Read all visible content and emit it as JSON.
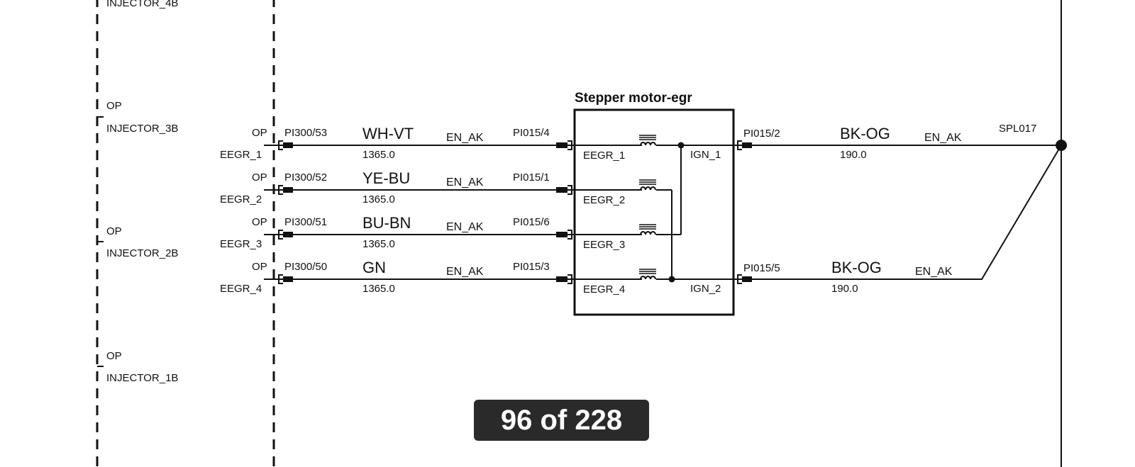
{
  "diagram": {
    "component_title": "Stepper motor-egr",
    "left_connectors": [
      {
        "op": "OP",
        "name": "INJECTOR_4B"
      },
      {
        "op": "OP",
        "name": "INJECTOR_3B"
      },
      {
        "op": "OP",
        "name": "INJECTOR_2B"
      },
      {
        "op": "OP",
        "name": "INJECTOR_1B"
      }
    ],
    "wires": [
      {
        "op": "OP",
        "pin": "EEGR_1",
        "from": "PI300/53",
        "color": "WH-VT",
        "length": "1365.0",
        "harness": "EN_AK",
        "to": "PI015/4",
        "internal": "EEGR_1"
      },
      {
        "op": "OP",
        "pin": "EEGR_2",
        "from": "PI300/52",
        "color": "YE-BU",
        "length": "1365.0",
        "harness": "EN_AK",
        "to": "PI015/1",
        "internal": "EEGR_2"
      },
      {
        "op": "OP",
        "pin": "EEGR_3",
        "from": "PI300/51",
        "color": "BU-BN",
        "length": "1365.0",
        "harness": "EN_AK",
        "to": "PI015/6",
        "internal": "EEGR_3"
      },
      {
        "op": "OP",
        "pin": "EEGR_4",
        "from": "PI300/50",
        "color": "GN",
        "length": "1365.0",
        "harness": "EN_AK",
        "to": "PI015/3",
        "internal": "EEGR_4"
      }
    ],
    "outputs": [
      {
        "internal": "IGN_1",
        "pin": "PI015/2",
        "color": "BK-OG",
        "length": "190.0",
        "harness": "EN_AK"
      },
      {
        "internal": "IGN_2",
        "pin": "PI015/5",
        "color": "BK-OG",
        "length": "190.0",
        "harness": "EN_AK"
      }
    ],
    "splice": "SPL017"
  },
  "pager": {
    "label": "96 of 228",
    "current": 96,
    "total": 228
  }
}
